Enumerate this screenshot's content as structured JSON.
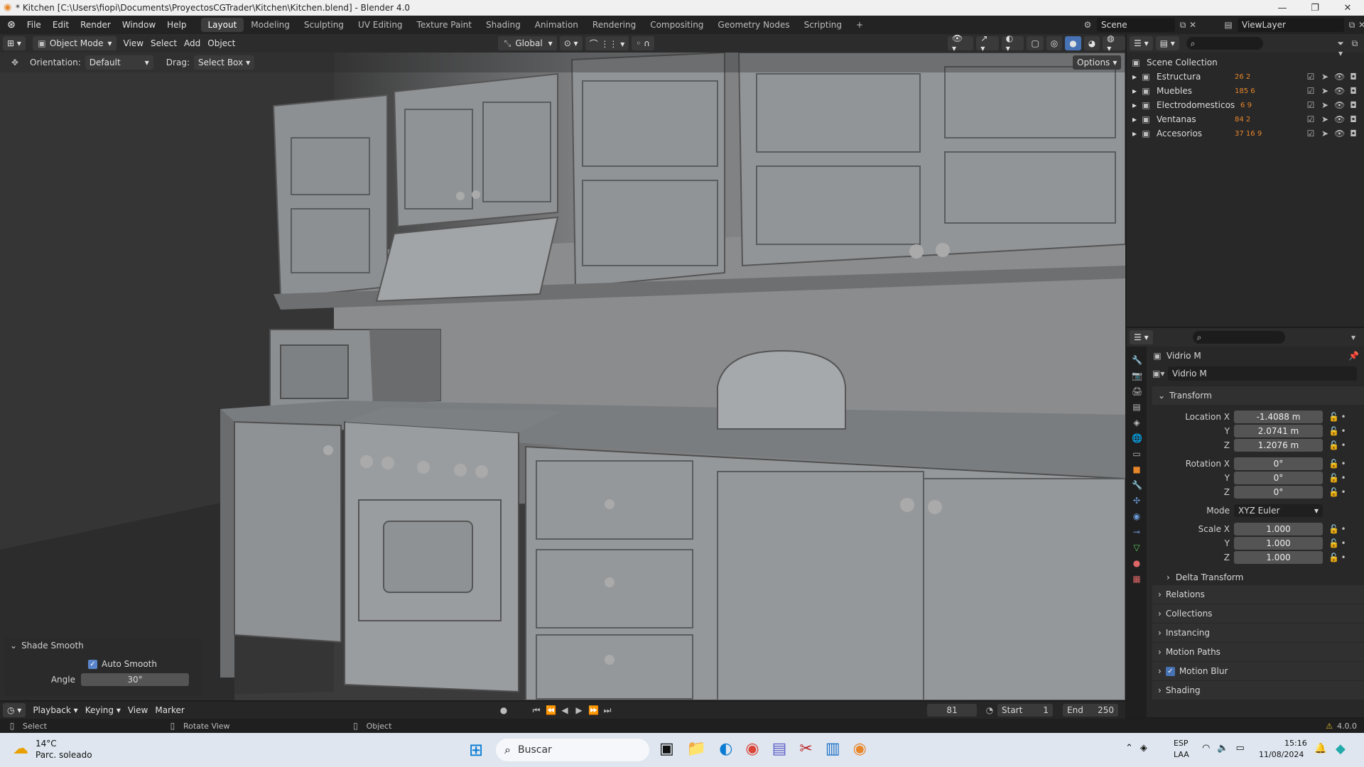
{
  "window": {
    "title": "* Kitchen [C:\\Users\\fiopi\\Documents\\ProyectosCGTrader\\Kitchen\\Kitchen.blend] - Blender 4.0"
  },
  "menu": [
    "File",
    "Edit",
    "Render",
    "Window",
    "Help"
  ],
  "workspaces": [
    "Layout",
    "Modeling",
    "Sculpting",
    "UV Editing",
    "Texture Paint",
    "Shading",
    "Animation",
    "Rendering",
    "Compositing",
    "Geometry Nodes",
    "Scripting"
  ],
  "scene": {
    "name": "Scene",
    "view_layer": "ViewLayer"
  },
  "header": {
    "mode": "Object Mode",
    "menus": [
      "View",
      "Select",
      "Add",
      "Object"
    ],
    "transform": "Global"
  },
  "tool": {
    "orientation_label": "Orientation:",
    "orientation": "Default",
    "drag_label": "Drag:",
    "drag": "Select Box",
    "options": "Options"
  },
  "outliner": {
    "root": "Scene Collection",
    "items": [
      {
        "name": "Estructura",
        "counts": "26 2"
      },
      {
        "name": "Muebles",
        "counts": "185 6"
      },
      {
        "name": "Electrodomesticos",
        "counts": "6 9"
      },
      {
        "name": "Ventanas",
        "counts": "84 2"
      },
      {
        "name": "Accesorios",
        "counts": "37 16 9"
      }
    ]
  },
  "properties": {
    "object_name": "Vidrio M",
    "data_name": "Vidrio M",
    "transform_title": "Transform",
    "location": {
      "label": "Location X",
      "x": "-1.4088 m",
      "y": "2.0741 m",
      "z": "1.2076 m"
    },
    "rotation": {
      "label": "Rotation X",
      "x": "0°",
      "y": "0°",
      "z": "0°"
    },
    "mode_label": "Mode",
    "mode": "XYZ Euler",
    "scale": {
      "label": "Scale X",
      "x": "1.000",
      "y": "1.000",
      "z": "1.000"
    },
    "axis_y": "Y",
    "axis_z": "Z",
    "sections": [
      "Delta Transform",
      "Relations",
      "Collections",
      "Instancing",
      "Motion Paths",
      "Motion Blur",
      "Shading"
    ]
  },
  "redo_panel": {
    "title": "Shade Smooth",
    "auto_smooth": "Auto Smooth",
    "angle_label": "Angle",
    "angle": "30°"
  },
  "timeline": {
    "menus": [
      "Playback",
      "Keying",
      "View",
      "Marker"
    ],
    "frame": "81",
    "start_label": "Start",
    "start": "1",
    "end_label": "End",
    "end": "250"
  },
  "status": {
    "select": "Select",
    "rotate": "Rotate View",
    "object": "Object",
    "version": "4.0.0"
  },
  "taskbar": {
    "temp": "14°C",
    "weather": "Parc. soleado",
    "search": "Buscar",
    "lang": "ESP",
    "layout": "LAA",
    "time": "15:16",
    "date": "11/08/2024"
  },
  "colors": {
    "accent": "#4772b3",
    "active_orange": "#e8862a",
    "bg": "#1d1d1d"
  }
}
